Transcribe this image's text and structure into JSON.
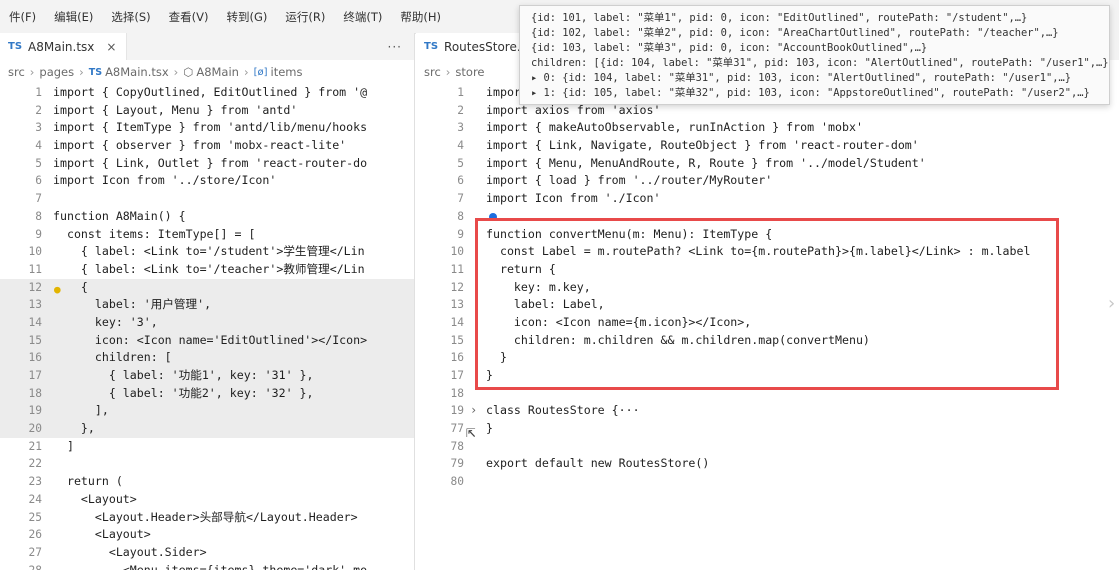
{
  "menubar": [
    "件(F)",
    "编辑(E)",
    "选择(S)",
    "查看(V)",
    "转到(G)",
    "运行(R)",
    "终端(T)",
    "帮助(H)"
  ],
  "left": {
    "tab": {
      "badge": "TS",
      "name": "A8Main.tsx",
      "close": "×"
    },
    "more": "···",
    "breadcrumb": {
      "p1": "src",
      "p2": "pages",
      "p3": "A8Main.tsx",
      "p4": "A8Main",
      "p5": "items"
    },
    "lines": [
      {
        "n": "1",
        "t": "import { CopyOutlined, EditOutlined } from '@"
      },
      {
        "n": "2",
        "t": "import { Layout, Menu } from 'antd'"
      },
      {
        "n": "3",
        "t": "import { ItemType } from 'antd/lib/menu/hooks"
      },
      {
        "n": "4",
        "t": "import { observer } from 'mobx-react-lite'"
      },
      {
        "n": "5",
        "t": "import { Link, Outlet } from 'react-router-do"
      },
      {
        "n": "6",
        "t": "import Icon from '../store/Icon'"
      },
      {
        "n": "7",
        "t": ""
      },
      {
        "n": "8",
        "t": "function A8Main() {"
      },
      {
        "n": "9",
        "t": "  const items: ItemType[] = ["
      },
      {
        "n": "10",
        "t": "    { label: <Link to='/student'>学生管理</Lin"
      },
      {
        "n": "11",
        "t": "    { label: <Link to='/teacher'>教师管理</Lin"
      },
      {
        "n": "12",
        "t": "    {"
      },
      {
        "n": "13",
        "t": "      label: '用户管理',"
      },
      {
        "n": "14",
        "t": "      key: '3',"
      },
      {
        "n": "15",
        "t": "      icon: <Icon name='EditOutlined'></Icon>"
      },
      {
        "n": "16",
        "t": "      children: ["
      },
      {
        "n": "17",
        "t": "        { label: '功能1', key: '31' },"
      },
      {
        "n": "18",
        "t": "        { label: '功能2', key: '32' },"
      },
      {
        "n": "19",
        "t": "      ],"
      },
      {
        "n": "20",
        "t": "    },"
      },
      {
        "n": "21",
        "t": "  ]"
      },
      {
        "n": "22",
        "t": ""
      },
      {
        "n": "23",
        "t": "  return ("
      },
      {
        "n": "24",
        "t": "    <Layout>"
      },
      {
        "n": "25",
        "t": "      <Layout.Header>头部导航</Layout.Header>"
      },
      {
        "n": "26",
        "t": "      <Layout>"
      },
      {
        "n": "27",
        "t": "        <Layout.Sider>"
      },
      {
        "n": "28",
        "t": "          <Menu items={items} theme='dark' mo"
      }
    ]
  },
  "right": {
    "tab": {
      "badge": "TS",
      "name": "RoutesStore."
    },
    "breadcrumb": {
      "p1": "src",
      "p2": "store"
    },
    "lines": [
      {
        "n": "1",
        "t": "import"
      },
      {
        "n": "2",
        "t": "import axios from 'axios'"
      },
      {
        "n": "3",
        "t": "import { makeAutoObservable, runInAction } from 'mobx'"
      },
      {
        "n": "4",
        "t": "import { Link, Navigate, RouteObject } from 'react-router-dom'"
      },
      {
        "n": "5",
        "t": "import { Menu, MenuAndRoute, R, Route } from '../model/Student'"
      },
      {
        "n": "6",
        "t": "import { load } from '../router/MyRouter'"
      },
      {
        "n": "7",
        "t": "import Icon from './Icon'"
      },
      {
        "n": "8",
        "t": ""
      },
      {
        "n": "9",
        "t": "function convertMenu(m: Menu): ItemType {"
      },
      {
        "n": "10",
        "t": "  const Label = m.routePath? <Link to={m.routePath}>{m.label}</Link> : m.label"
      },
      {
        "n": "11",
        "t": "  return {"
      },
      {
        "n": "12",
        "t": "    key: m.key,"
      },
      {
        "n": "13",
        "t": "    label: Label,"
      },
      {
        "n": "14",
        "t": "    icon: <Icon name={m.icon}></Icon>,"
      },
      {
        "n": "15",
        "t": "    children: m.children && m.children.map(convertMenu)"
      },
      {
        "n": "16",
        "t": "  }"
      },
      {
        "n": "17",
        "t": "}"
      },
      {
        "n": "18",
        "t": ""
      },
      {
        "n": "19",
        "t": "class RoutesStore {···"
      },
      {
        "n": "77",
        "t": "}"
      },
      {
        "n": "78",
        "t": ""
      },
      {
        "n": "79",
        "t": "export default new RoutesStore()"
      },
      {
        "n": "80",
        "t": ""
      }
    ]
  },
  "tooltip": [
    "{id: 101, label: \"菜单1\", pid: 0, icon: \"EditOutlined\", routePath: \"/student\",…}",
    "{id: 102, label: \"菜单2\", pid: 0, icon: \"AreaChartOutlined\", routePath: \"/teacher\",…}",
    "{id: 103, label: \"菜单3\", pid: 0, icon: \"AccountBookOutlined\",…}",
    "children: [{id: 104, label: \"菜单31\", pid: 103, icon: \"AlertOutlined\", routePath: \"/user1\",…},…]",
    "▸ 0: {id: 104, label: \"菜单31\", pid: 103, icon: \"AlertOutlined\", routePath: \"/user1\",…}",
    "▸ 1: {id: 105, label: \"菜单32\", pid: 103, icon: \"AppstoreOutlined\", routePath: \"/user2\",…}"
  ]
}
